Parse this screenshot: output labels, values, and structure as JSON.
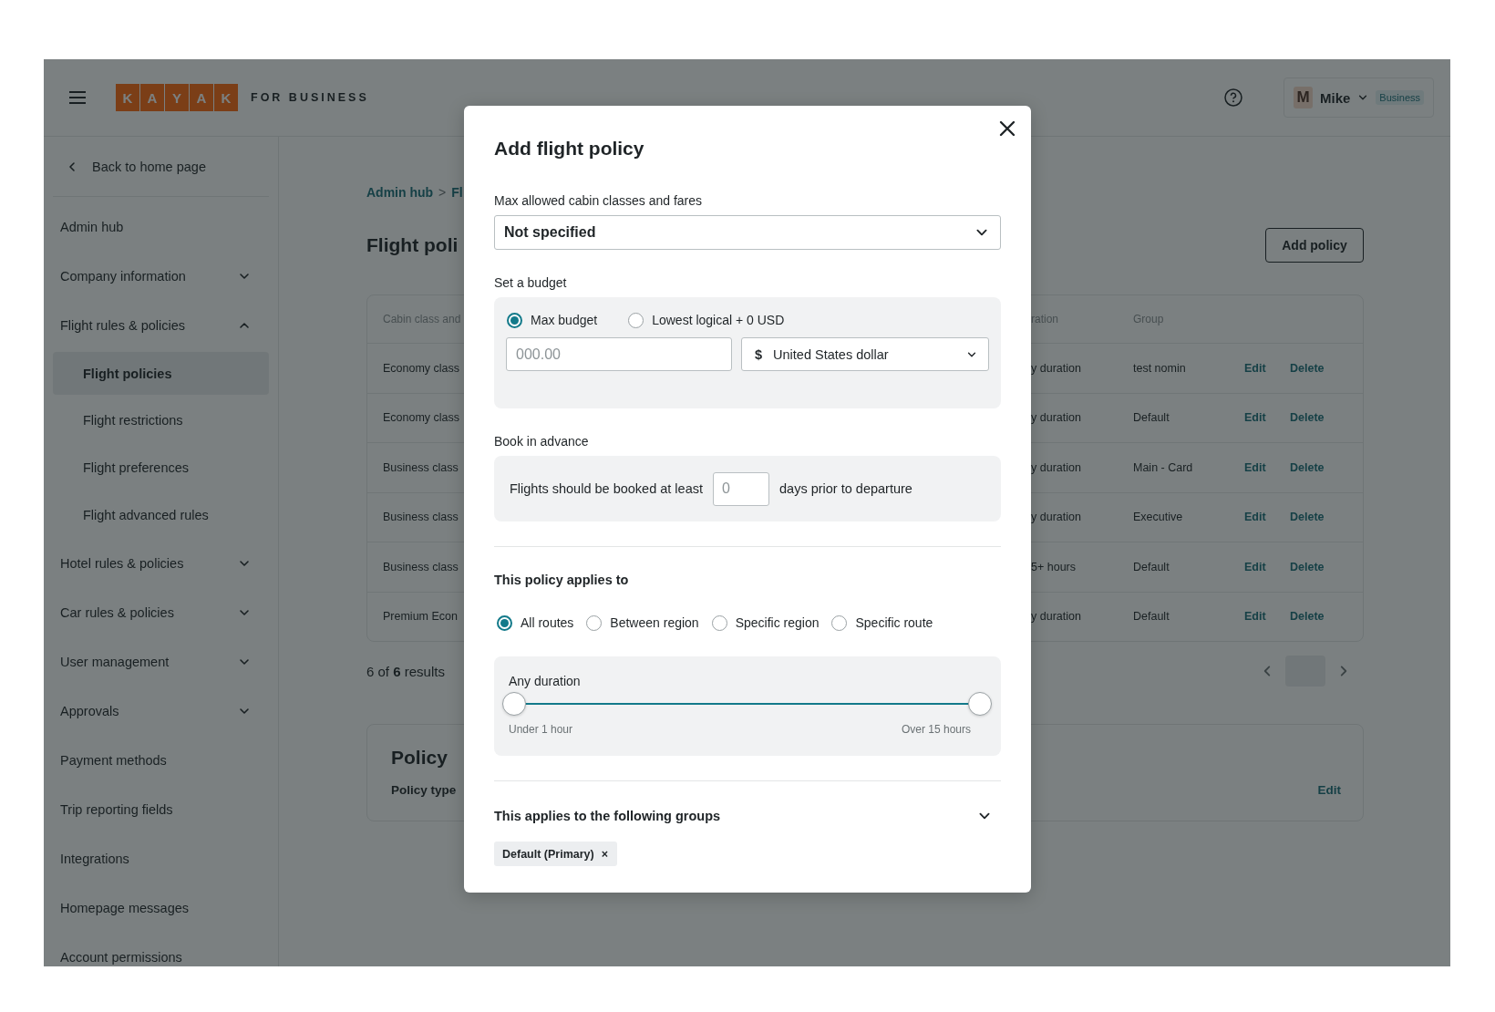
{
  "header": {
    "logo_letters": [
      "K",
      "A",
      "Y",
      "A",
      "K"
    ],
    "logo_suffix": "FOR BUSINESS",
    "user": {
      "initial": "M",
      "name": "Mike",
      "badge": "Business"
    }
  },
  "sidebar": {
    "back_link": "Back to home page",
    "items": [
      {
        "label": "Admin hub",
        "kind": "link",
        "selected": false
      },
      {
        "label": "Company information",
        "kind": "group",
        "expanded": false,
        "selected": false
      },
      {
        "label": "Flight rules & policies",
        "kind": "group",
        "expanded": true,
        "selected": false,
        "children": [
          {
            "label": "Flight policies",
            "selected": true
          },
          {
            "label": "Flight restrictions",
            "selected": false
          },
          {
            "label": "Flight preferences",
            "selected": false
          },
          {
            "label": "Flight advanced rules",
            "selected": false
          }
        ]
      },
      {
        "label": "Hotel rules & policies",
        "kind": "group",
        "expanded": false,
        "selected": false
      },
      {
        "label": "Car rules & policies",
        "kind": "group",
        "expanded": false,
        "selected": false
      },
      {
        "label": "User management",
        "kind": "group",
        "expanded": false,
        "selected": false
      },
      {
        "label": "Approvals",
        "kind": "group",
        "expanded": false,
        "selected": false
      },
      {
        "label": "Payment methods",
        "kind": "link",
        "selected": false
      },
      {
        "label": "Trip reporting fields",
        "kind": "link",
        "selected": false
      },
      {
        "label": "Integrations",
        "kind": "link",
        "selected": false
      },
      {
        "label": "Homepage messages",
        "kind": "link",
        "selected": false
      },
      {
        "label": "Account permissions",
        "kind": "link",
        "selected": false
      }
    ]
  },
  "main": {
    "breadcrumb": {
      "items": [
        "Admin hub",
        "Fl"
      ],
      "separator": ">"
    },
    "title": "Flight poli",
    "add_button": "Add policy",
    "table": {
      "columns": [
        "Cabin class and",
        "ration",
        "Group"
      ],
      "rows": [
        {
          "cabin": "Economy class",
          "duration": "y duration",
          "group": "test nomin",
          "edit": "Edit",
          "delete": "Delete"
        },
        {
          "cabin": "Economy class",
          "duration": "y duration",
          "group": "Default",
          "edit": "Edit",
          "delete": "Delete"
        },
        {
          "cabin": "Business class",
          "duration": "y duration",
          "group": "Main - Card",
          "edit": "Edit",
          "delete": "Delete"
        },
        {
          "cabin": "Business class",
          "duration": "y duration",
          "group": "Executive",
          "edit": "Edit",
          "delete": "Delete"
        },
        {
          "cabin": "Business class",
          "duration": "5+ hours",
          "group": "Default",
          "edit": "Edit",
          "delete": "Delete"
        },
        {
          "cabin": "Premium Econ",
          "duration": "y duration",
          "group": "Default",
          "edit": "Edit",
          "delete": "Delete"
        }
      ]
    },
    "results": "6 of **6** results",
    "policy_card": {
      "title": "Policy",
      "label": "Policy type",
      "edit": "Edit"
    }
  },
  "modal": {
    "title": "Add flight policy",
    "cabin": {
      "label": "Max allowed cabin classes and fares",
      "value": "Not specified"
    },
    "budget": {
      "label": "Set a budget",
      "options": [
        {
          "label": "Max budget",
          "selected": true
        },
        {
          "label": "Lowest logical + 0 USD",
          "selected": false
        }
      ],
      "amount": {
        "placeholder": "000.00"
      },
      "currency": {
        "symbol": "$",
        "value": "United States dollar"
      }
    },
    "advance": {
      "label": "Book in advance",
      "before": "Flights should be booked at least",
      "days": {
        "placeholder": "0"
      },
      "after": "days prior to departure"
    },
    "applies": {
      "label": "This policy applies to",
      "options": [
        {
          "label": "All routes",
          "selected": true
        },
        {
          "label": "Between region",
          "selected": false
        },
        {
          "label": "Specific region",
          "selected": false
        },
        {
          "label": "Specific route",
          "selected": false
        }
      ],
      "duration": {
        "label": "Any duration",
        "thumbs": [
          {
            "level": 0
          },
          {
            "level": 1
          }
        ],
        "min_label": "Under 1 hour",
        "max_label": "Over 15 hours"
      }
    },
    "groups": {
      "label": "This applies to the following groups",
      "chips": [
        {
          "label": "Default (Primary)",
          "remove": "×"
        }
      ]
    }
  }
}
